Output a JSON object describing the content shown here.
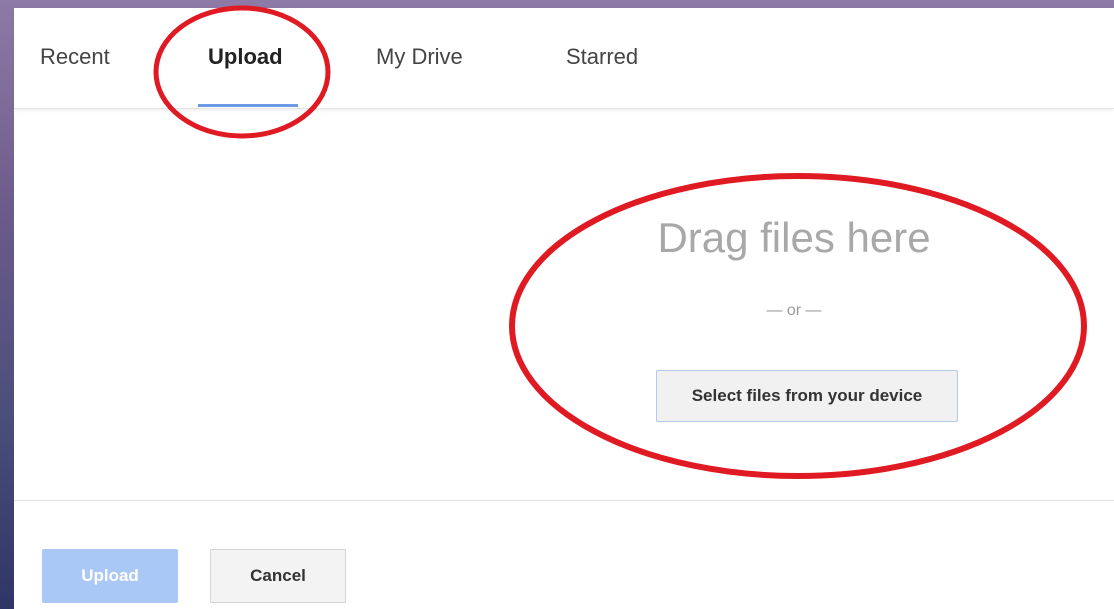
{
  "tabs": [
    {
      "label": "Recent",
      "active": false
    },
    {
      "label": "Upload",
      "active": true
    },
    {
      "label": "My Drive",
      "active": false
    },
    {
      "label": "Starred",
      "active": false
    }
  ],
  "drop_zone": {
    "heading": "Drag files here",
    "separator": "— or —",
    "select_button": "Select files from your device"
  },
  "footer": {
    "upload_button": "Upload",
    "upload_enabled": false,
    "cancel_button": "Cancel"
  },
  "colors": {
    "active_tab_underline": "#6b9ae6",
    "annotation_red": "#e01a22",
    "upload_button_disabled": "#a9c8f5"
  }
}
